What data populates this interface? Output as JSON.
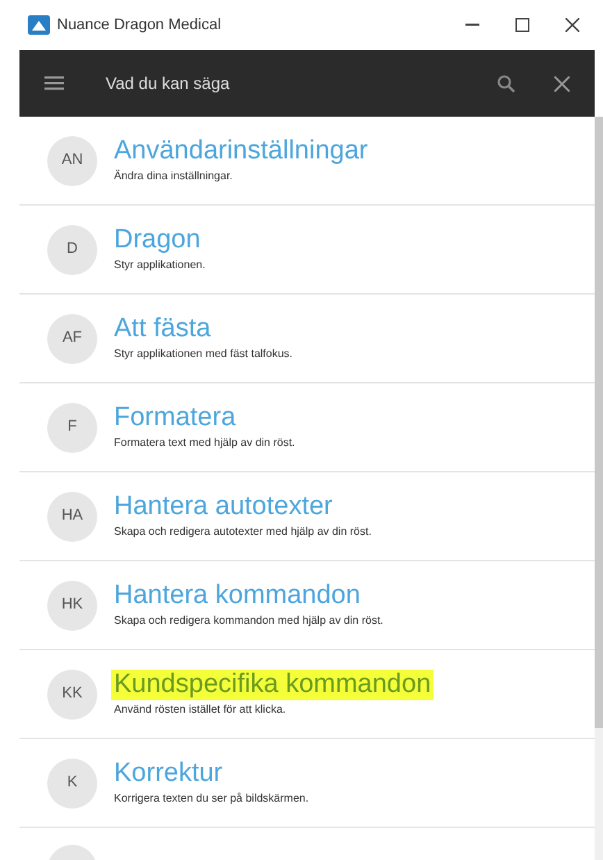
{
  "window": {
    "title": "Nuance Dragon Medical"
  },
  "header": {
    "title": "Vad du kan säga"
  },
  "items": [
    {
      "initials": "AN",
      "title": "Användarinställningar",
      "subtitle": "Ändra dina inställningar.",
      "highlighted": false
    },
    {
      "initials": "D",
      "title": "Dragon",
      "subtitle": "Styr applikationen.",
      "highlighted": false
    },
    {
      "initials": "AF",
      "title": "Att fästa",
      "subtitle": "Styr applikationen med fäst talfokus.",
      "highlighted": false
    },
    {
      "initials": "F",
      "title": "Formatera",
      "subtitle": "Formatera text med hjälp av din röst.",
      "highlighted": false
    },
    {
      "initials": "HA",
      "title": "Hantera autotexter",
      "subtitle": "Skapa och redigera autotexter med hjälp av din röst.",
      "highlighted": false
    },
    {
      "initials": "HK",
      "title": "Hantera kommandon",
      "subtitle": "Skapa och redigera kommandon med hjälp av din röst.",
      "highlighted": false
    },
    {
      "initials": "KK",
      "title": "Kundspecifika kommandon",
      "subtitle": "Använd rösten istället för att klicka.",
      "highlighted": true
    },
    {
      "initials": "K",
      "title": "Korrektur",
      "subtitle": "Korrigera texten du ser på bildskärmen.",
      "highlighted": false
    }
  ]
}
